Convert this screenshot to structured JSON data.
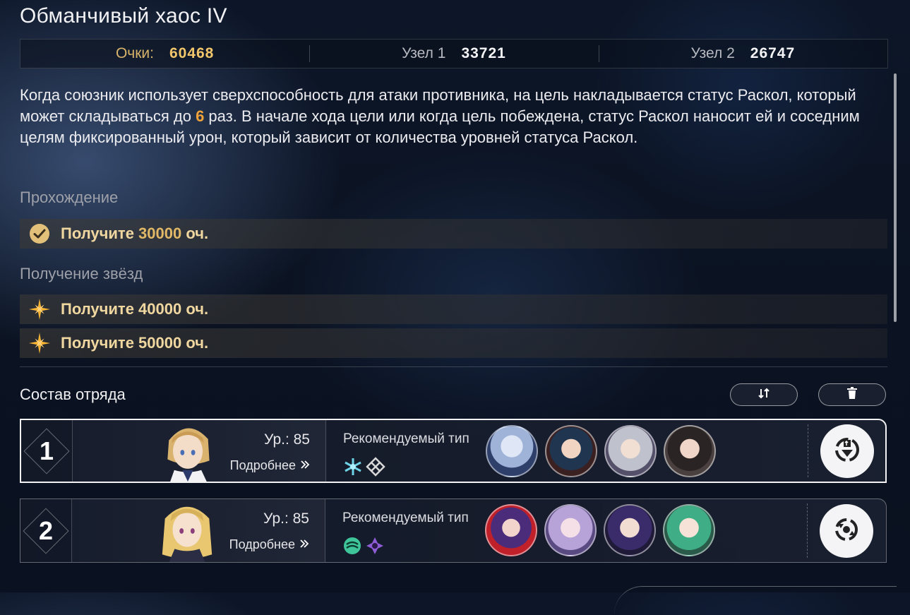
{
  "header": {
    "title": "Обманчивый хаос IV"
  },
  "scores": {
    "points_label": "Очки:",
    "points_value": "60468",
    "node1_label": "Узел 1",
    "node1_value": "33721",
    "node2_label": "Узел 2",
    "node2_value": "26747"
  },
  "description": {
    "part1": "Когда союзник использует сверхспособность для атаки противника, на цель накладывается статус Раскол, который может складываться до ",
    "highlight": "6",
    "part2": " раз. В начале хода цели или когда цель побеждена, статус Раскол наносит ей и соседним целям фиксированный урон, который зависит от количества уровней статуса Раскол."
  },
  "completion": {
    "label": "Прохождение",
    "items": [
      {
        "prefix": "Получите ",
        "points": "30000",
        "suffix": " оч.",
        "icon": "check-circle-icon"
      }
    ]
  },
  "stars": {
    "label": "Получение звёзд",
    "items": [
      {
        "prefix": "Получите ",
        "points": "40000",
        "suffix": " оч.",
        "icon": "star-icon"
      },
      {
        "prefix": "Получите ",
        "points": "50000",
        "suffix": " оч.",
        "icon": "star-icon"
      }
    ]
  },
  "team": {
    "title": "Состав отряда",
    "swap_icon": "swap-icon",
    "delete_icon": "trash-icon",
    "cards": [
      {
        "number": "1",
        "level": "Ур.: 85",
        "more": "Подробнее",
        "recommended_label": "Рекомендуемый тип",
        "types": [
          "ice-type-icon",
          "imaginary-type-icon"
        ],
        "avatars": [
          "avatar-1",
          "avatar-2",
          "avatar-3",
          "avatar-4"
        ],
        "action_icon": "team-action-icon"
      },
      {
        "number": "2",
        "level": "Ур.: 85",
        "more": "Подробнее",
        "recommended_label": "Рекомендуемый тип",
        "types": [
          "wind-type-icon",
          "quantum-type-icon"
        ],
        "avatars": [
          "avatar-5",
          "avatar-6",
          "avatar-7",
          "avatar-8"
        ],
        "action_icon": "team-action-icon"
      }
    ]
  },
  "colors": {
    "gold": "#f2c66b",
    "highlight": "#f0a23a",
    "text": "#ececf0",
    "muted": "#9da0a8"
  }
}
